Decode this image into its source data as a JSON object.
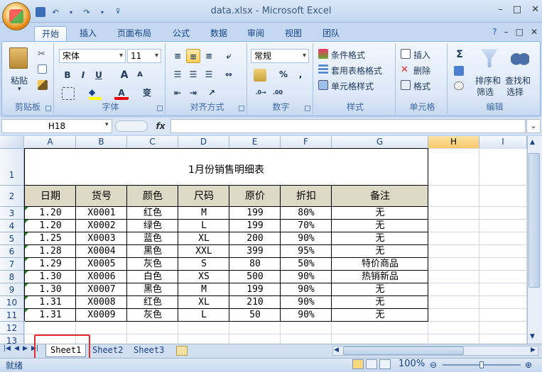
{
  "window": {
    "title": "data.xlsx - Microsoft Excel",
    "min": "–",
    "max": "□",
    "close": "✕"
  },
  "ribbon_tabs": [
    "开始",
    "插入",
    "页面布局",
    "公式",
    "数据",
    "审阅",
    "视图",
    "团队"
  ],
  "active_tab": "开始",
  "ribbon": {
    "clipboard": {
      "paste": "粘贴",
      "label": "剪贴板"
    },
    "font": {
      "name": "宋体",
      "size": "11",
      "bold": "B",
      "italic": "I",
      "underline": "U",
      "grow": "A",
      "shrink": "A",
      "label": "字体",
      "phonetic": "变"
    },
    "alignment": {
      "label": "对齐方式"
    },
    "number": {
      "format": "常规",
      "percent": "%",
      "comma": ",",
      "label": "数字"
    },
    "styles": {
      "conditional": "条件格式",
      "table": "套用表格格式",
      "cell": "单元格样式",
      "label": "样式"
    },
    "cells": {
      "insert": "插入",
      "delete": "删除",
      "format": "格式",
      "label": "单元格"
    },
    "editing": {
      "sigma": "Σ",
      "sort": "排序和",
      "sort2": "筛选",
      "find": "查找和",
      "find2": "选择",
      "label": "编辑"
    }
  },
  "formula_bar": {
    "name_box": "H18",
    "fx": "fx",
    "formula": ""
  },
  "columns": [
    "A",
    "B",
    "C",
    "D",
    "E",
    "F",
    "G",
    "H",
    "I"
  ],
  "selected_column": "H",
  "rows": [
    "1",
    "2",
    "3",
    "4",
    "5",
    "6",
    "7",
    "8",
    "9",
    "10",
    "11",
    "12",
    "13"
  ],
  "sheet": {
    "title": "1月份销售明细表",
    "headers": [
      "日期",
      "货号",
      "颜色",
      "尺码",
      "原价",
      "折扣",
      "备注"
    ],
    "data": [
      [
        "1.20",
        "X0001",
        "红色",
        "M",
        "199",
        "80%",
        "无"
      ],
      [
        "1.20",
        "X0002",
        "绿色",
        "L",
        "199",
        "70%",
        "无"
      ],
      [
        "1.25",
        "X0003",
        "蓝色",
        "XL",
        "200",
        "90%",
        "无"
      ],
      [
        "1.28",
        "X0004",
        "黑色",
        "XXL",
        "399",
        "95%",
        "无"
      ],
      [
        "1.29",
        "X0005",
        "灰色",
        "S",
        "80",
        "50%",
        "特价商品"
      ],
      [
        "1.30",
        "X0006",
        "白色",
        "XS",
        "500",
        "90%",
        "热销新品"
      ],
      [
        "1.30",
        "X0007",
        "黑色",
        "M",
        "199",
        "90%",
        "无"
      ],
      [
        "1.31",
        "X0008",
        "红色",
        "XL",
        "210",
        "90%",
        "无"
      ],
      [
        "1.31",
        "X0009",
        "灰色",
        "L",
        "50",
        "90%",
        "无"
      ]
    ]
  },
  "sheet_tabs": [
    "Sheet1",
    "Sheet2",
    "Sheet3"
  ],
  "active_sheet": "Sheet1",
  "status": {
    "ready": "就绪",
    "zoom": "100%"
  },
  "colors": {
    "header_fill": "#ddd9c4",
    "highlight": "#e32b2b",
    "ribbon_blue": "#c4d8f1"
  }
}
